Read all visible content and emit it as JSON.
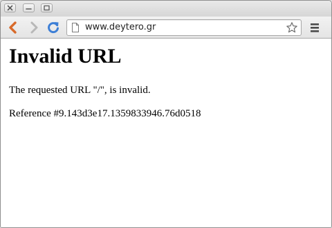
{
  "window": {
    "buttons": [
      {
        "name": "close",
        "icon": "close-icon"
      },
      {
        "name": "minimize",
        "icon": "minimize-icon"
      },
      {
        "name": "maximize",
        "icon": "maximize-icon"
      }
    ]
  },
  "toolbar": {
    "back_icon": "back-arrow-icon",
    "forward_icon": "forward-arrow-icon",
    "reload_icon": "reload-icon",
    "menu_icon": "menu-icon"
  },
  "address_bar": {
    "url": "www.deytero.gr",
    "page_icon": "page-icon",
    "bookmark_icon": "star-icon"
  },
  "page": {
    "title": "Invalid URL",
    "message": "The requested URL \"/\", is invalid.",
    "reference": "Reference #9.143d3e17.1359833946.76d0518"
  },
  "colors": {
    "back_arrow": "#d86a2a",
    "reload": "#3d7fd6",
    "forward_disabled": "#b8b8b8"
  }
}
